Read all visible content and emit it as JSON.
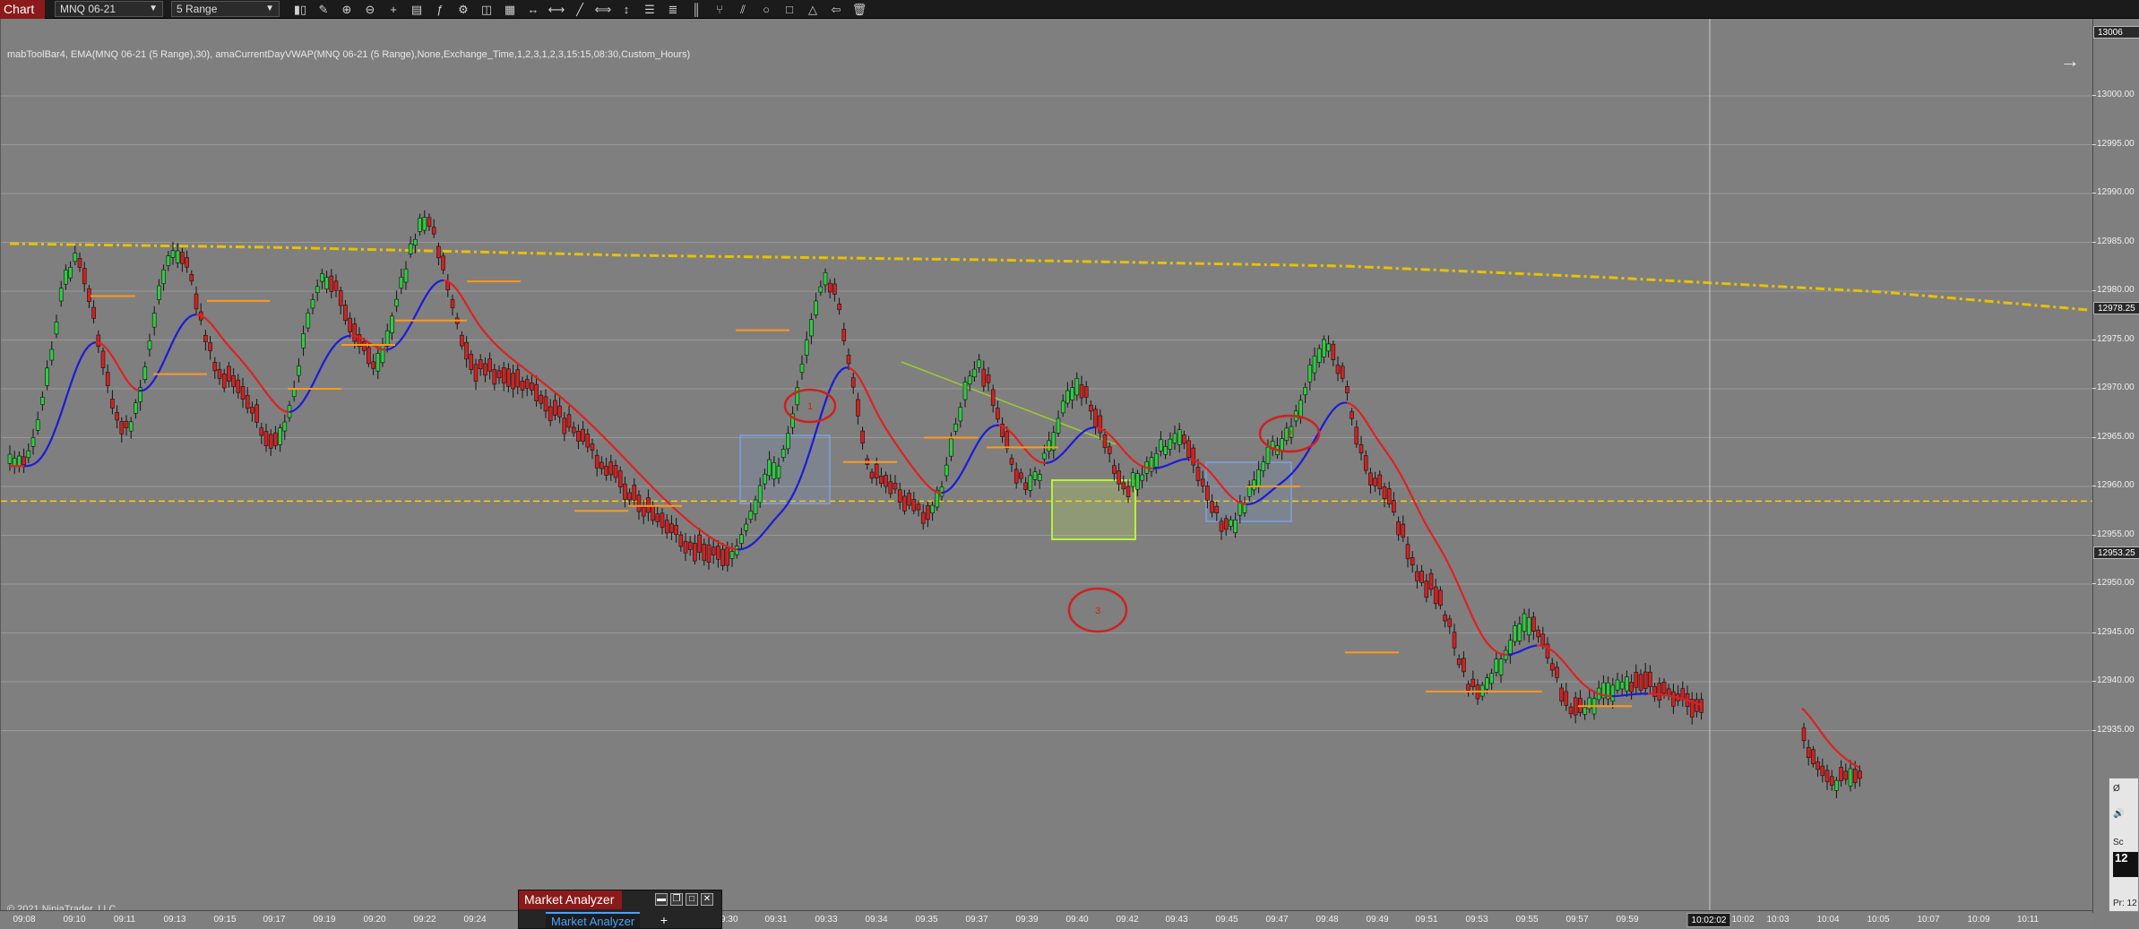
{
  "toolbar": {
    "chart_tab": "Chart",
    "instrument": "MNQ 06-21",
    "bar_type": "5 Range",
    "tools": [
      {
        "name": "bar-chart-icon",
        "glyph": "▮▯"
      },
      {
        "name": "pencil-icon",
        "glyph": "✎"
      },
      {
        "name": "zoom-in-icon",
        "glyph": "⊕"
      },
      {
        "name": "zoom-out-icon",
        "glyph": "⊖"
      },
      {
        "name": "crosshair-icon",
        "glyph": "+"
      },
      {
        "name": "data-box-icon",
        "glyph": "▤"
      },
      {
        "name": "indicators-icon",
        "glyph": "ƒ"
      },
      {
        "name": "strategies-icon",
        "glyph": "⚙"
      },
      {
        "name": "screenshot-icon",
        "glyph": "◫"
      },
      {
        "name": "properties-icon",
        "glyph": "▦"
      },
      {
        "name": "ruler-icon",
        "glyph": "↔"
      },
      {
        "name": "horizontal-line-icon",
        "glyph": "⟷"
      },
      {
        "name": "trend-line-icon",
        "glyph": "╱"
      },
      {
        "name": "extended-line-icon",
        "glyph": "⟺"
      },
      {
        "name": "vertical-line-icon",
        "glyph": "↕"
      },
      {
        "name": "fib-retracement-icon",
        "glyph": "☰"
      },
      {
        "name": "fib-extension-icon",
        "glyph": "≣"
      },
      {
        "name": "fib-time-icon",
        "glyph": "║"
      },
      {
        "name": "andrews-pitchfork-icon",
        "glyph": "⑂"
      },
      {
        "name": "parallel-channel-icon",
        "glyph": "⫽"
      },
      {
        "name": "ellipse-icon",
        "glyph": "○"
      },
      {
        "name": "rectangle-icon",
        "glyph": "□"
      },
      {
        "name": "triangle-icon",
        "glyph": "△"
      },
      {
        "name": "arrow-icon",
        "glyph": "⇦"
      },
      {
        "name": "trash-icon",
        "glyph": "🗑"
      }
    ]
  },
  "indicator_label": "mabToolBar4, EMA(MNQ 06-21 (5 Range),30), amaCurrentDayVWAP(MNQ 06-21 (5 Range),None,Exchange_Time,1,2,3,1,2,3,15:15,08:30,Custom_Hours)",
  "copyright": "© 2021 NinjaTrader, LLC",
  "arrow_glyph": "→",
  "price_axis": {
    "ticks": [
      "13000.00",
      "12995.00",
      "12990.00",
      "12985.00",
      "12980.00",
      "12975.00",
      "12970.00",
      "12965.00",
      "12960.00",
      "12955.00",
      "12950.00",
      "12945.00",
      "12940.00",
      "12935.00"
    ],
    "flag_top": "13006",
    "flag_ema": "12978.25",
    "flag_price": "12953.25"
  },
  "time_axis": {
    "ticks": [
      "09:08",
      "09:10",
      "09:11",
      "09:13",
      "09:15",
      "09:17",
      "09:19",
      "09:20",
      "09:22",
      "09:24",
      "09:30",
      "09:31",
      "09:33",
      "09:34",
      "09:35",
      "09:37",
      "09:39",
      "09:40",
      "09:42",
      "09:43",
      "09:45",
      "09:47",
      "09:48",
      "09:49",
      "09:51",
      "09:53",
      "09:55",
      "09:57",
      "09:59",
      "10:02",
      "10:03",
      "10:04",
      "10:05",
      "10:07",
      "10:09",
      "10:11"
    ],
    "cursor_time": "10:02:02"
  },
  "market_analyzer": {
    "title": "Market Analyzer",
    "tab": "Market Analyzer",
    "plus": "+",
    "buttons": [
      "▬",
      "❐",
      "□",
      "✕"
    ]
  },
  "side_widget": {
    "item1": "Ø",
    "item2": "🔊",
    "item3": "Sc",
    "box": "12",
    "footer": "Pr: 12"
  },
  "annotations": [
    "1",
    "2",
    "3"
  ],
  "colors": {
    "background": "#7f7f7f",
    "bull_candle": "#2ecc40",
    "bear_candle": "#d42020",
    "ema_up": "#1a1adb",
    "ema_down": "#e02020",
    "vwap": "#e6c200",
    "support": "#ffd000",
    "chart_tab": "#8b1a1a"
  },
  "chart_data": {
    "type": "candlestick",
    "instrument": "MNQ 06-21",
    "bar_type": "5 Range",
    "ylim": [
      12929,
      13008
    ],
    "indicators": [
      "EMA(30)",
      "amaCurrentDayVWAP"
    ],
    "support_level": 12958.5,
    "path_points": [
      {
        "t": "09:08",
        "p": 12963
      },
      {
        "t": "09:10",
        "p": 12983
      },
      {
        "t": "09:11",
        "p": 12966
      },
      {
        "t": "09:13",
        "p": 12984
      },
      {
        "t": "09:15",
        "p": 12971
      },
      {
        "t": "09:17",
        "p": 12965
      },
      {
        "t": "09:19",
        "p": 12981
      },
      {
        "t": "09:20",
        "p": 12973
      },
      {
        "t": "09:22",
        "p": 12987
      },
      {
        "t": "09:24",
        "p": 12972
      },
      {
        "t": "09:30",
        "p": 12953
      },
      {
        "t": "09:31",
        "p": 12962
      },
      {
        "t": "09:33",
        "p": 12981
      },
      {
        "t": "09:34",
        "p": 12961
      },
      {
        "t": "09:35",
        "p": 12957
      },
      {
        "t": "09:37",
        "p": 12972
      },
      {
        "t": "09:39",
        "p": 12960
      },
      {
        "t": "09:40",
        "p": 12970
      },
      {
        "t": "09:42",
        "p": 12960
      },
      {
        "t": "09:43",
        "p": 12965
      },
      {
        "t": "09:45",
        "p": 12956
      },
      {
        "t": "09:47",
        "p": 12964
      },
      {
        "t": "09:48",
        "p": 12974
      },
      {
        "t": "09:49",
        "p": 12960
      },
      {
        "t": "09:51",
        "p": 12950
      },
      {
        "t": "09:53",
        "p": 12939
      },
      {
        "t": "09:55",
        "p": 12946
      },
      {
        "t": "09:57",
        "p": 12937
      },
      {
        "t": "09:59",
        "p": 12940
      },
      {
        "t": "10:02",
        "p": 12936
      },
      {
        "t": "10:03",
        "p": 12939
      },
      {
        "t": "10:04",
        "p": 12930
      }
    ]
  }
}
